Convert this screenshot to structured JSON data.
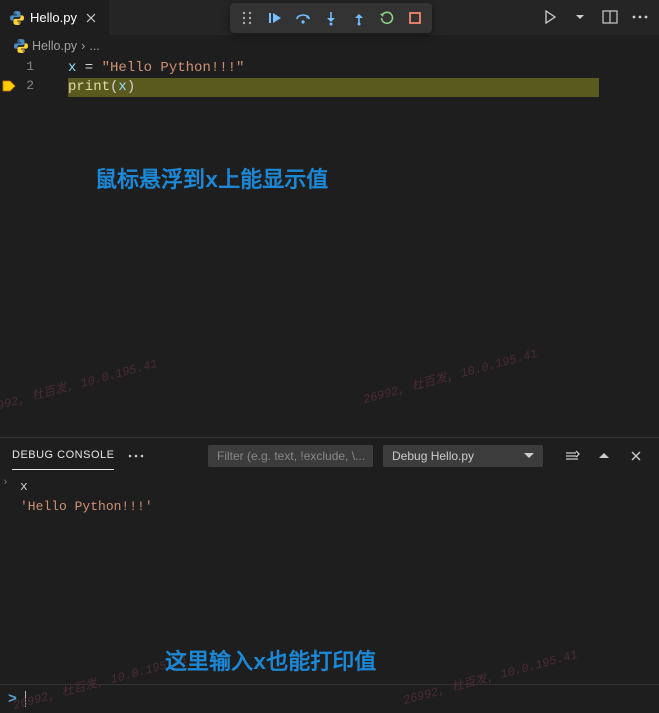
{
  "tab": {
    "filename": "Hello.py"
  },
  "breadcrumb": {
    "file": "Hello.py",
    "sep": "›",
    "more": "..."
  },
  "code": {
    "line1": {
      "var": "x",
      "op": " = ",
      "str": "\"Hello Python!!!\""
    },
    "line2": {
      "fn": "print",
      "lp": "(",
      "arg": "x",
      "rp": ")"
    }
  },
  "lineNumbers": [
    "1",
    "2"
  ],
  "annotations": {
    "hover": "鼠标悬浮到x上能显示值",
    "repl": "这里输入x也能打印值"
  },
  "panel": {
    "tab": "DEBUG CONSOLE",
    "filterPlaceholder": "Filter (e.g. text, !exclude, \\...",
    "session": "Debug Hello.py"
  },
  "console": {
    "input": "x",
    "output": "'Hello Python!!!'"
  },
  "watermark": "26992, 杜百发, 10.0.195.41"
}
